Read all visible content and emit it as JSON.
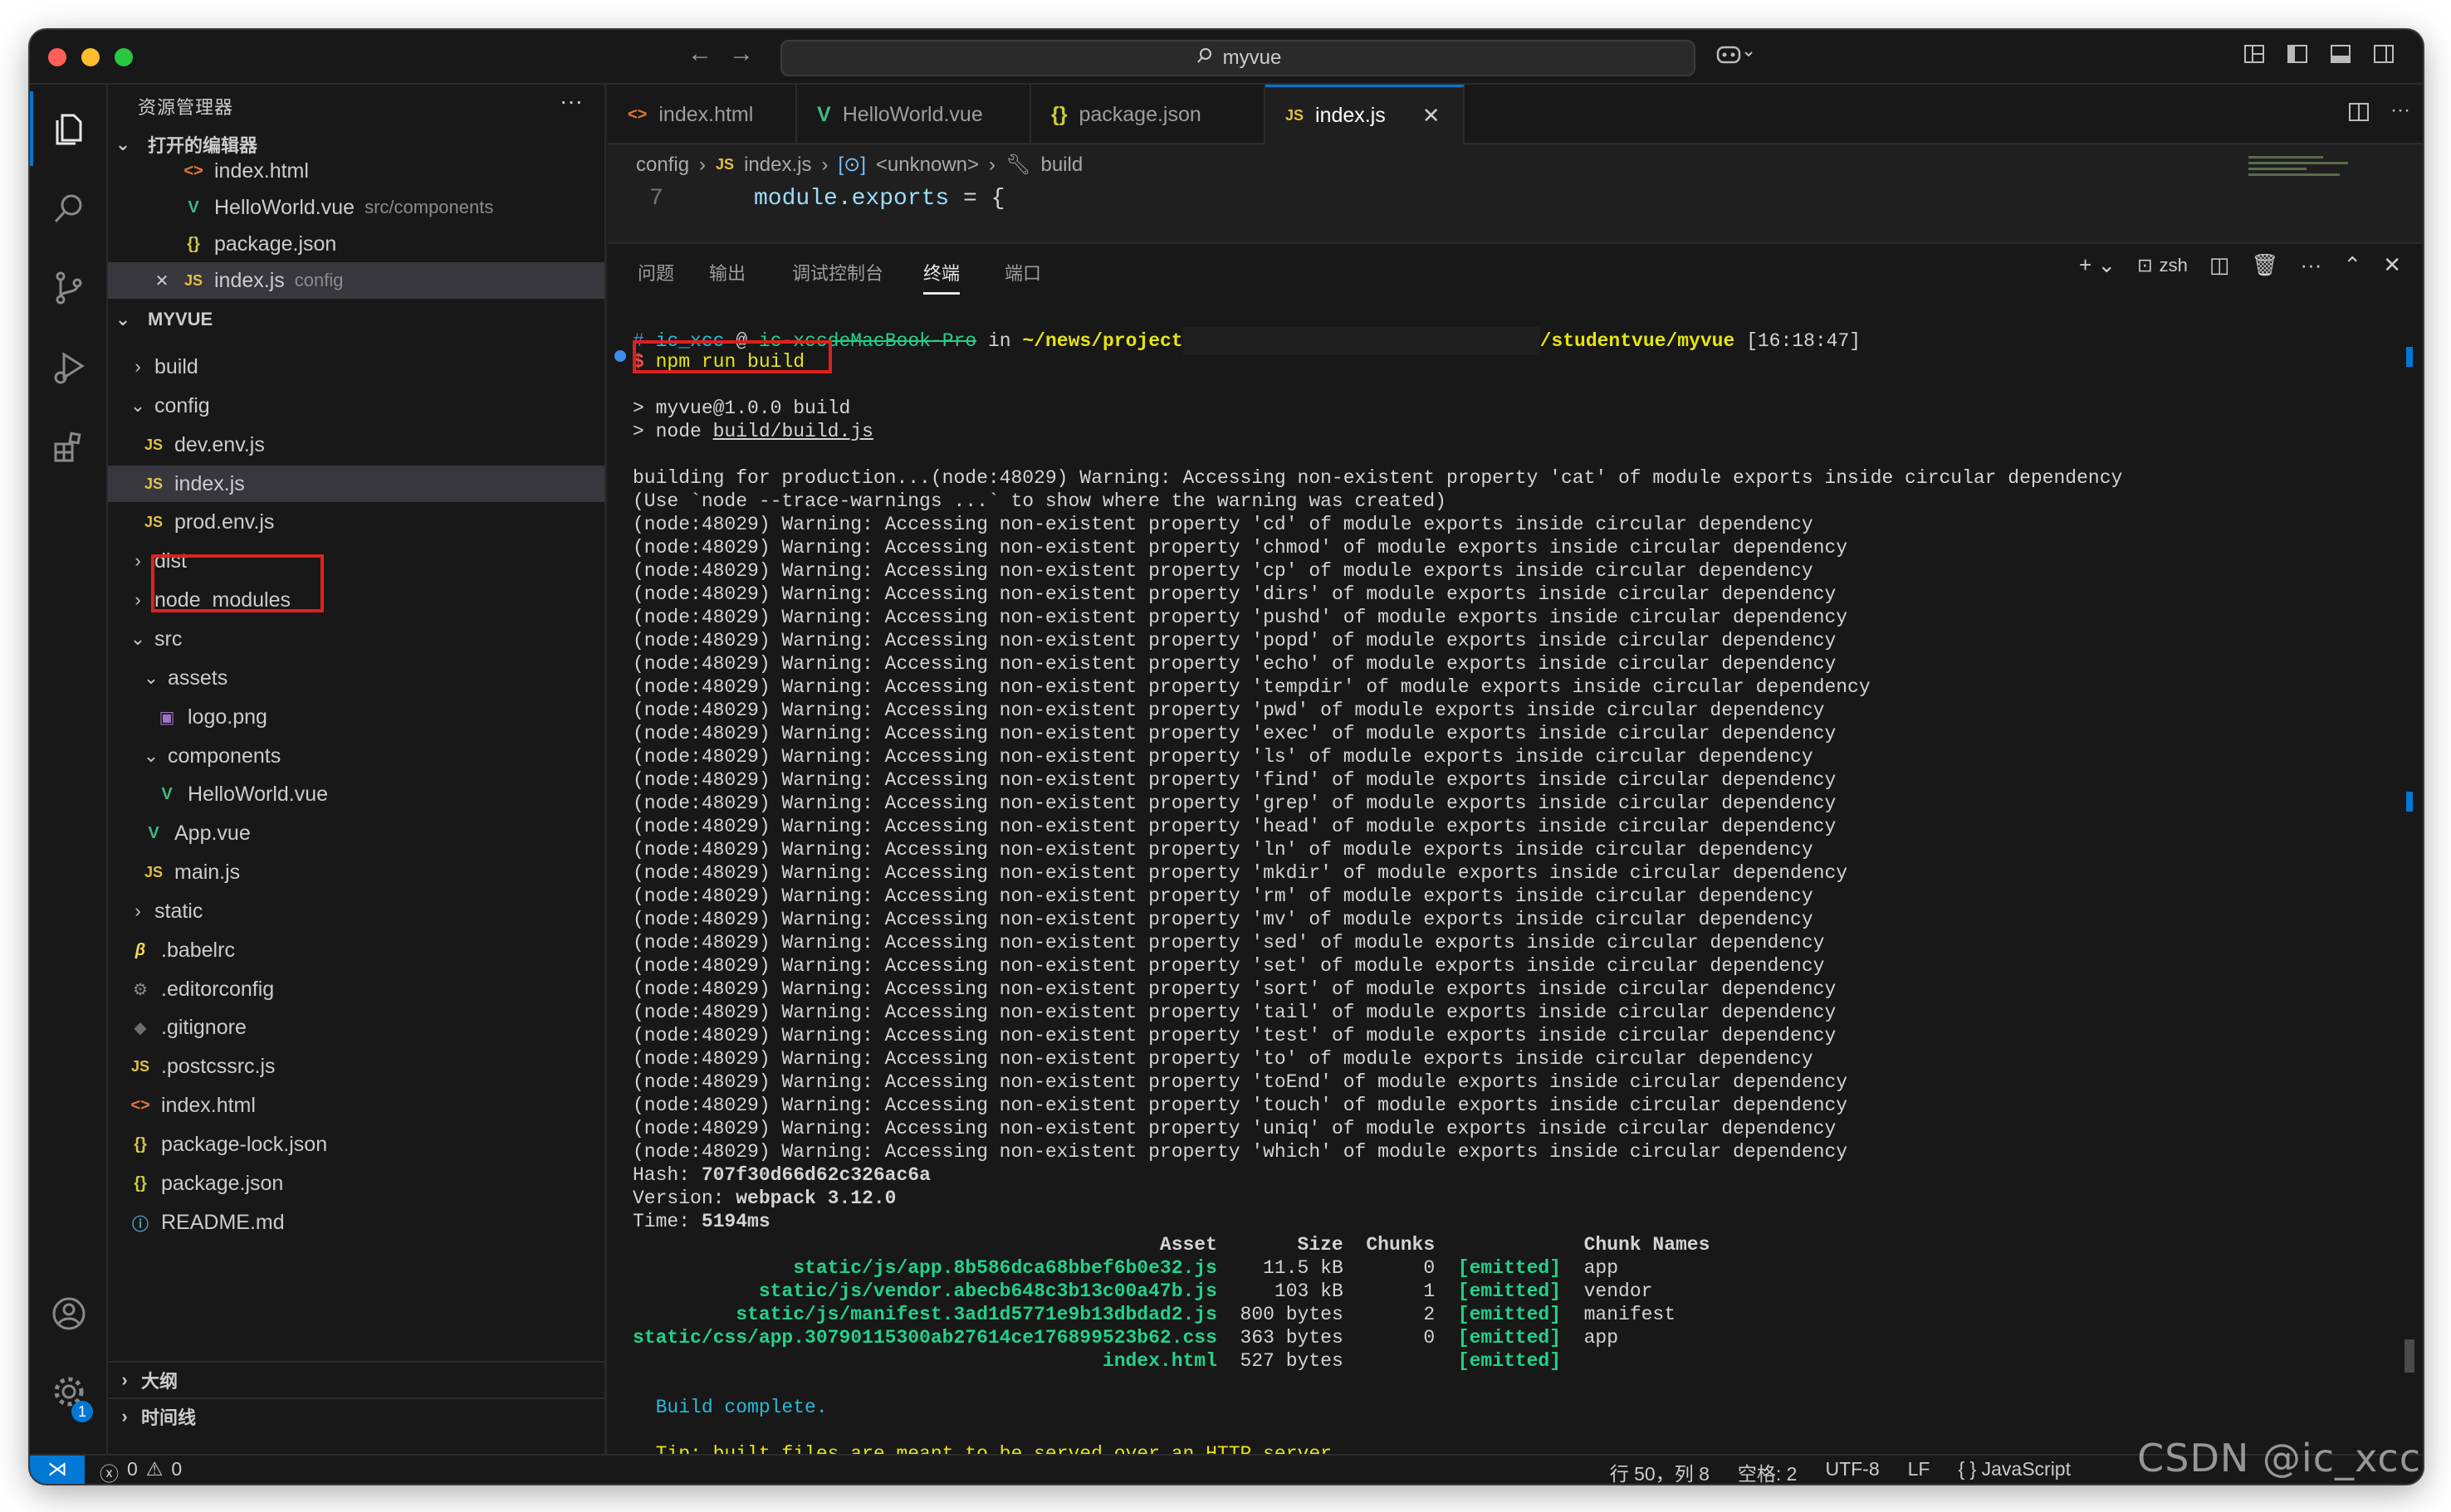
{
  "titlebar": {
    "search_text": "myvue"
  },
  "sidebar": {
    "title": "资源管理器",
    "open_editors_label": "打开的编辑器",
    "open_editors": [
      {
        "name": "index.html",
        "desc": "",
        "icon": "html-file-icon"
      },
      {
        "name": "HelloWorld.vue",
        "desc": "src/components",
        "icon": "vue-file-icon"
      },
      {
        "name": "package.json",
        "desc": "",
        "icon": "json-file-icon"
      },
      {
        "name": "index.js",
        "desc": "config",
        "icon": "js-file-icon"
      }
    ],
    "project_label": "MYVUE",
    "tree": [
      {
        "name": "build",
        "type": "folder"
      },
      {
        "name": "config",
        "type": "folder-open"
      },
      {
        "name": "dev.env.js",
        "type": "js"
      },
      {
        "name": "index.js",
        "type": "js"
      },
      {
        "name": "prod.env.js",
        "type": "js"
      },
      {
        "name": "dist",
        "type": "folder"
      },
      {
        "name": "node_modules",
        "type": "folder"
      },
      {
        "name": "src",
        "type": "folder-open"
      },
      {
        "name": "assets",
        "type": "folder-open"
      },
      {
        "name": "logo.png",
        "type": "img"
      },
      {
        "name": "components",
        "type": "folder-open"
      },
      {
        "name": "HelloWorld.vue",
        "type": "vue"
      },
      {
        "name": "App.vue",
        "type": "vue"
      },
      {
        "name": "main.js",
        "type": "js"
      },
      {
        "name": "static",
        "type": "folder"
      },
      {
        "name": ".babelrc",
        "type": "babel"
      },
      {
        "name": ".editorconfig",
        "type": "gear"
      },
      {
        "name": ".gitignore",
        "type": "git"
      },
      {
        "name": ".postcssrc.js",
        "type": "js"
      },
      {
        "name": "index.html",
        "type": "html"
      },
      {
        "name": "package-lock.json",
        "type": "json"
      },
      {
        "name": "package.json",
        "type": "json"
      },
      {
        "name": "README.md",
        "type": "info"
      }
    ],
    "outline_label": "大纲",
    "timeline_label": "时间线"
  },
  "tabs": [
    {
      "label": "index.html",
      "icon": "html-file-icon"
    },
    {
      "label": "HelloWorld.vue",
      "icon": "vue-file-icon"
    },
    {
      "label": "package.json",
      "icon": "json-file-icon"
    },
    {
      "label": "index.js",
      "icon": "js-file-icon"
    }
  ],
  "breadcrumb": {
    "folder": "config",
    "file": "index.js",
    "symbol": "<unknown>",
    "prop": "build"
  },
  "code": {
    "line_number": "7",
    "text_a": "module.exports",
    "text_b": " = {"
  },
  "panel": {
    "tabs": [
      "问题",
      "输出",
      "调试控制台",
      "终端",
      "端口"
    ],
    "shell": "zsh"
  },
  "terminal": {
    "prompt_user": "ic_xcc",
    "prompt_host": "ic-xccdeMacBook-Pro",
    "prompt_path_a": "~/news/project",
    "prompt_path_b": "/studentvue/myvue",
    "prompt_time": "[16:18:47]",
    "command": "npm run build",
    "script_lines": [
      "> myvue@1.0.0 build",
      "> node build/build.js"
    ],
    "building_line": "building for production...(node:48029) Warning: Accessing non-existent property 'cat' of module exports inside circular dependency",
    "trace_line": "(Use `node --trace-warnings ...` to show where the warning was created)",
    "warning_props": [
      "cd",
      "chmod",
      "cp",
      "dirs",
      "pushd",
      "popd",
      "echo",
      "tempdir",
      "pwd",
      "exec",
      "ls",
      "find",
      "grep",
      "head",
      "ln",
      "mkdir",
      "rm",
      "mv",
      "sed",
      "set",
      "sort",
      "tail",
      "test",
      "to",
      "toEnd",
      "touch",
      "uniq",
      "which"
    ],
    "hash": "707f30d66d62c326ac6a",
    "version": "webpack 3.12.0",
    "time": "5194ms",
    "assets_header": [
      "Asset",
      "Size",
      "Chunks",
      "",
      "Chunk Names"
    ],
    "assets": [
      {
        "asset": "static/js/app.8b586dca68bbef6b0e32.js",
        "size": "11.5 kB",
        "chunk": "0",
        "status": "[emitted]",
        "name": "app"
      },
      {
        "asset": "static/js/vendor.abecb648c3b13c00a47b.js",
        "size": "103 kB",
        "chunk": "1",
        "status": "[emitted]",
        "name": "vendor"
      },
      {
        "asset": "static/js/manifest.3ad1d5771e9b13dbdad2.js",
        "size": "800 bytes",
        "chunk": "2",
        "status": "[emitted]",
        "name": "manifest"
      },
      {
        "asset": "static/css/app.30790115300ab27614ce176899523b62.css",
        "size": "363 bytes",
        "chunk": "0",
        "status": "[emitted]",
        "name": "app"
      },
      {
        "asset": "index.html",
        "size": "527 bytes",
        "chunk": "",
        "status": "[emitted]",
        "name": ""
      }
    ],
    "build_complete": "Build complete.",
    "tip": "Tip: built files are meant to be served over an HTTP server."
  },
  "statusbar": {
    "errors": "0",
    "warnings": "0",
    "position": "行 50，列 8",
    "spaces": "空格: 2",
    "encoding": "UTF-8",
    "eol": "LF",
    "language": "{ } JavaScript"
  },
  "watermark": "CSDN @ic_xcc"
}
